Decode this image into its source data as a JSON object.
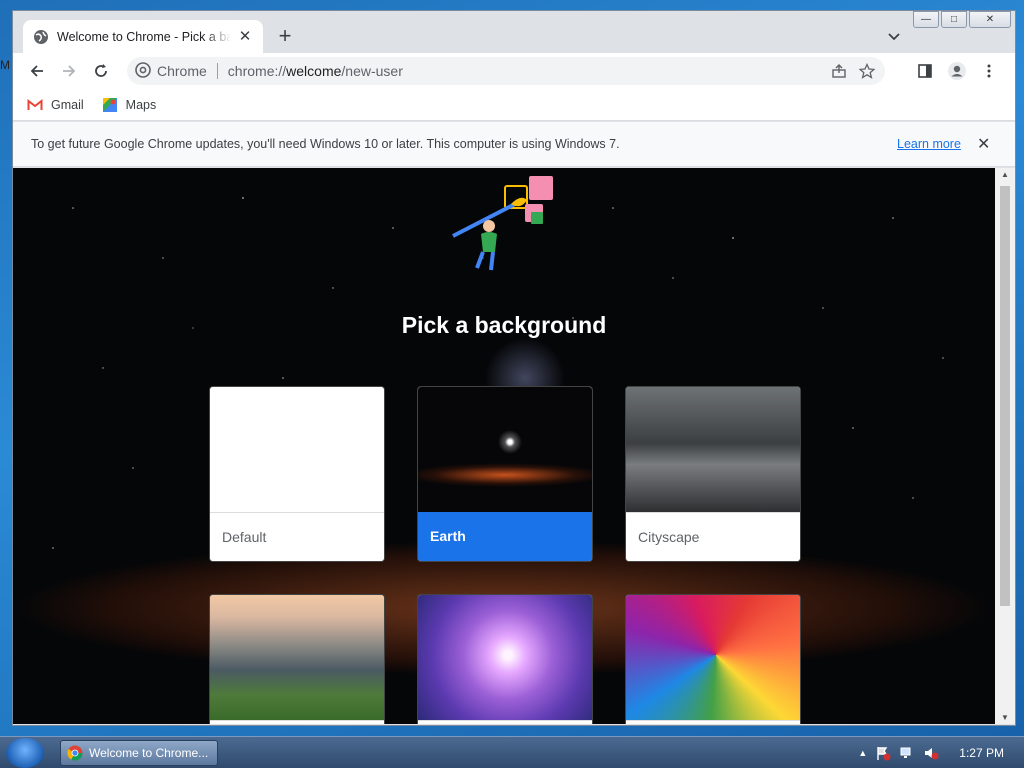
{
  "window": {
    "tab_title": "Welcome to Chrome - Pick a background",
    "new_tab_symbol": "+",
    "controls": {
      "minimize": "—",
      "maximize": "□",
      "close": "✕"
    }
  },
  "toolbar": {
    "site_label": "Chrome",
    "url_prefix": "chrome://",
    "url_host": "welcome",
    "url_path": "/new-user"
  },
  "bookmarks": [
    {
      "label": "Gmail",
      "icon": "gmail-icon"
    },
    {
      "label": "Maps",
      "icon": "maps-icon"
    }
  ],
  "infobar": {
    "message": "To get future Google Chrome updates, you'll need Windows 10 or later. This computer is using Windows 7.",
    "link": "Learn more",
    "close": "✕"
  },
  "page": {
    "heading": "Pick a background",
    "cards": [
      {
        "label": "Default",
        "selected": false
      },
      {
        "label": "Earth",
        "selected": true
      },
      {
        "label": "Cityscape",
        "selected": false
      },
      {
        "label": "",
        "selected": false
      },
      {
        "label": "",
        "selected": false
      },
      {
        "label": "",
        "selected": false
      }
    ]
  },
  "taskbar": {
    "item_label": "Welcome to Chrome...",
    "clock": "1:27 PM",
    "tray_arrow": "▲"
  },
  "colors": {
    "accent": "#1a73e8",
    "tab_strip": "#dee1e6"
  }
}
